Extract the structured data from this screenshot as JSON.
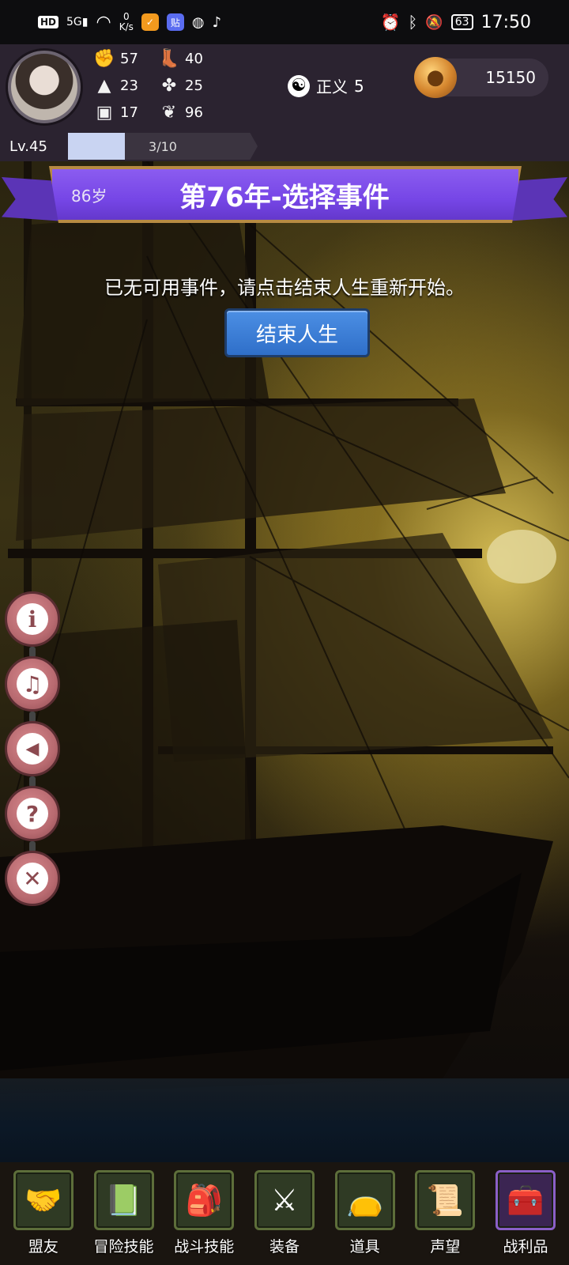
{
  "status_bar": {
    "hd": "HD",
    "signal": "5G",
    "net_speed_value": "0",
    "net_speed_unit": "K/s",
    "app_icon_2": "贴",
    "battery": "63",
    "time": "17:50"
  },
  "player": {
    "stats": [
      {
        "icon": "fist-icon",
        "value": "57"
      },
      {
        "icon": "boot-icon",
        "value": "40"
      },
      {
        "icon": "wizard-hat-icon",
        "value": "23"
      },
      {
        "icon": "clover-icon",
        "value": "25"
      },
      {
        "icon": "armor-icon",
        "value": "17"
      },
      {
        "icon": "laurel-icon",
        "value": "96"
      }
    ],
    "alignment": {
      "label": "正义",
      "value": "5"
    },
    "gold": "15150",
    "level": "Lv.45",
    "xp_text": "3/10",
    "xp_fraction": 0.3
  },
  "event": {
    "age": "86岁",
    "title": "第76年-选择事件",
    "message": "已无可用事件，请点击结束人生重新开始。",
    "end_button": "结束人生"
  },
  "side_menu": [
    {
      "name": "info-button",
      "icon": "info-icon",
      "glyph": "i"
    },
    {
      "name": "music-button",
      "icon": "music-note-icon",
      "glyph": "♫"
    },
    {
      "name": "sound-button",
      "icon": "speaker-icon",
      "glyph": "◀"
    },
    {
      "name": "help-button",
      "icon": "question-icon",
      "glyph": "?"
    },
    {
      "name": "close-button",
      "icon": "close-icon",
      "glyph": "✕"
    }
  ],
  "bottom_nav": [
    {
      "label": "盟友",
      "icon": "handshake-icon"
    },
    {
      "label": "冒险技能",
      "icon": "book-icon"
    },
    {
      "label": "战斗技能",
      "icon": "backpack-icon"
    },
    {
      "label": "装备",
      "icon": "swords-icon"
    },
    {
      "label": "道具",
      "icon": "pouch-icon"
    },
    {
      "label": "声望",
      "icon": "scroll-icon"
    },
    {
      "label": "战利品",
      "icon": "treasure-chest-icon"
    }
  ]
}
